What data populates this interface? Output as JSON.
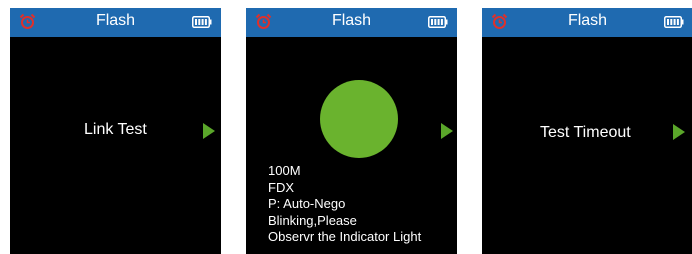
{
  "colors": {
    "header_bg": "#1f6ab0",
    "screen_bg": "#000000",
    "accent_green": "#6ab32e",
    "alarm_red": "#e0302a",
    "text": "#ffffff"
  },
  "icons": {
    "header_left": "alarm-clock-icon",
    "header_right": "battery-icon",
    "next": "play-arrow-icon",
    "indicator": "green-indicator-light"
  },
  "screens": [
    {
      "title": "Flash",
      "label": "Link Test"
    },
    {
      "title": "Flash",
      "lines": [
        "100M",
        "FDX",
        "P: Auto-Nego",
        "Blinking,Please",
        "Observr the Indicator Light"
      ]
    },
    {
      "title": "Flash",
      "label": "Test Timeout"
    }
  ]
}
